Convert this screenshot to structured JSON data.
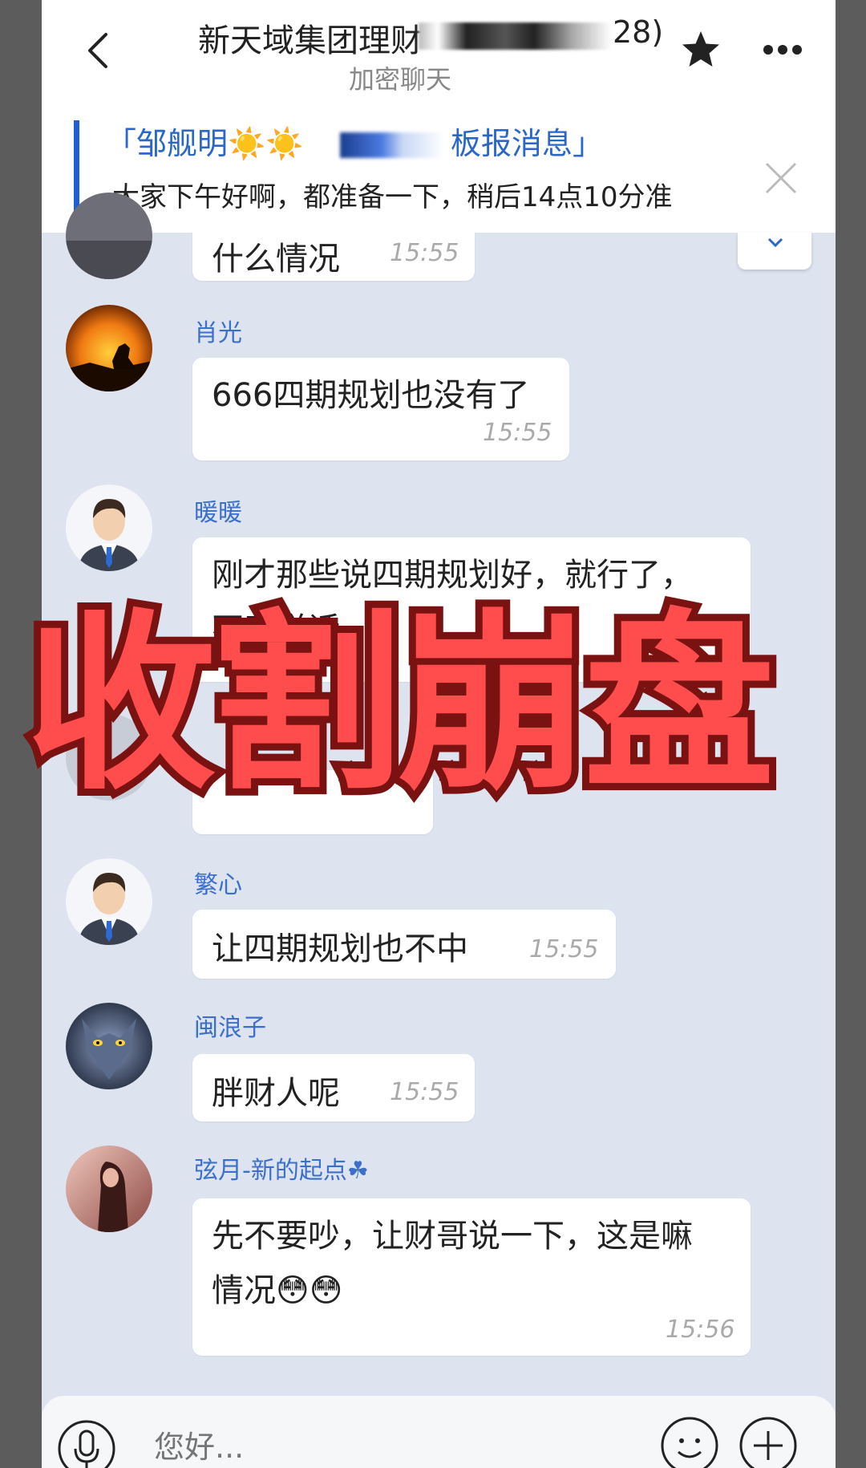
{
  "header": {
    "title": "新天域集团理财",
    "title_suffix": "28)",
    "subtitle": "加密聊天"
  },
  "announcement": {
    "title_start": "「邹舰明☀️☀️",
    "title_end": "板报消息」",
    "text": "大家下午好啊，都准备一下，稍后14点10分准"
  },
  "messages": [
    {
      "sender": "",
      "text": "什么情况",
      "time": "15:55"
    },
    {
      "sender": "肖光",
      "text": "666四期规划也没有了",
      "time": "15:55"
    },
    {
      "sender": "暖暖",
      "text_line1": "刚才那些说四期规划好，就行了，",
      "text_line2": "不叫说话",
      "time": ""
    },
    {
      "sender": "繁心",
      "text": "让四期规划也不中",
      "time": "15:55"
    },
    {
      "sender": "闽浪子",
      "text": "胖财人呢",
      "time": "15:55"
    },
    {
      "sender": "弦月-新的起点☘",
      "text_line1": "先不要吵，让财哥说一下，这是嘛",
      "text_line2": "情况😳😳",
      "time": "15:56"
    }
  ],
  "overlay": {
    "text": "收割崩盘"
  },
  "input": {
    "placeholder": "您好..."
  }
}
